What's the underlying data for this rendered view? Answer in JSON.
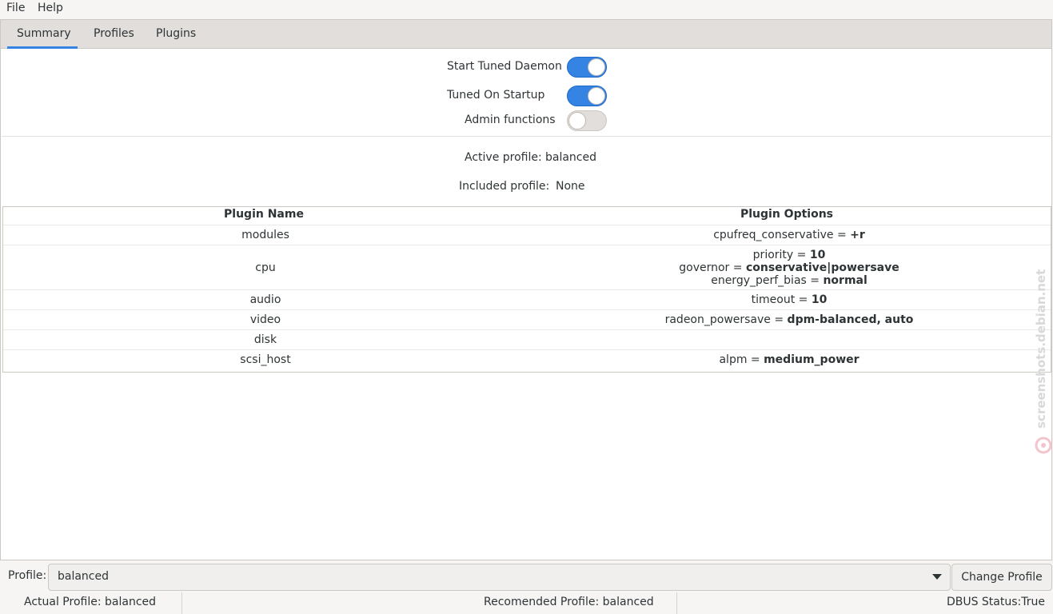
{
  "menu": {
    "file": "File",
    "help": "Help"
  },
  "tabs": [
    "Summary",
    "Profiles",
    "Plugins"
  ],
  "summary": {
    "start_daemon": {
      "label": "Start Tuned Daemon",
      "enabled": true
    },
    "on_startup": {
      "label": "Tuned On Startup",
      "enabled": true
    },
    "admin": {
      "label": "Admin functions",
      "enabled": false
    },
    "active_profile_label": "Active profile:",
    "active_profile_value": "balanced",
    "included_profile_label": "Included profile:",
    "included_profile_value": "None"
  },
  "plugin_table": {
    "headers": [
      "Plugin Name",
      "Plugin Options"
    ],
    "rows": [
      {
        "name": "modules",
        "options": [
          {
            "key": "cpufreq_conservative = ",
            "value": "+r"
          }
        ]
      },
      {
        "name": "cpu",
        "options": [
          {
            "key": "priority = ",
            "value": "10"
          },
          {
            "key": "governor = ",
            "value": "conservative|powersave"
          },
          {
            "key": "energy_perf_bias = ",
            "value": "normal"
          }
        ]
      },
      {
        "name": "audio",
        "options": [
          {
            "key": "timeout = ",
            "value": "10"
          }
        ]
      },
      {
        "name": "video",
        "options": [
          {
            "key": "radeon_powersave = ",
            "value": "dpm-balanced, auto"
          }
        ]
      },
      {
        "name": "disk",
        "options": []
      },
      {
        "name": "scsi_host",
        "options": [
          {
            "key": "alpm = ",
            "value": "medium_power"
          }
        ]
      }
    ]
  },
  "watermark": "screenshots.debian.net",
  "bottom": {
    "profile_label": "Profile:",
    "profile_value": "balanced",
    "change_button": "Change Profile"
  },
  "status": {
    "actual": "Actual Profile:  balanced",
    "recommended": "Recomended Profile:  balanced",
    "dbus": "DBUS Status:True"
  },
  "colors": {
    "accent": "#3584e4",
    "window_bg": "#f6f5f4"
  }
}
